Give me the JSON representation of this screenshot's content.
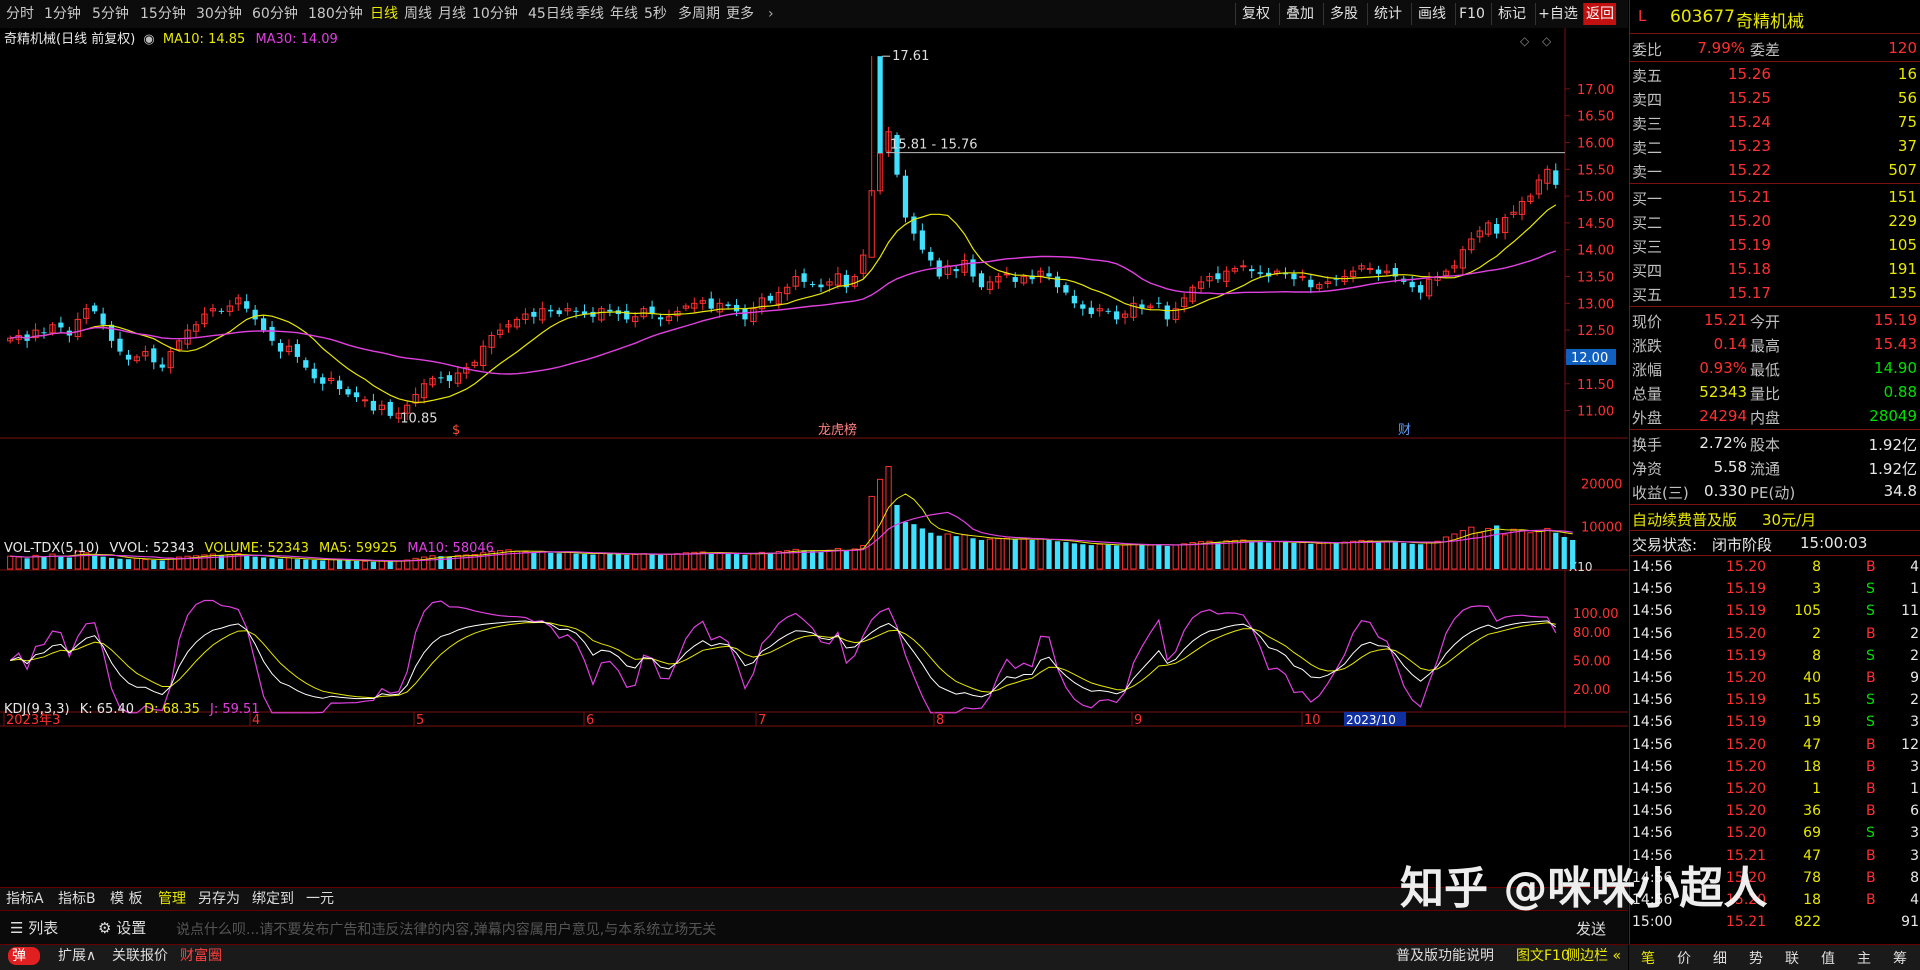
{
  "toolbar": {
    "periods": [
      "分时",
      "1分钟",
      "5分钟",
      "15分钟",
      "30分钟",
      "60分钟",
      "180分钟",
      "日线",
      "周线",
      "月线",
      "10分钟",
      "45日线",
      "季线",
      "年线",
      "5秒",
      "多周期",
      "更多"
    ],
    "selected": "日线",
    "right_buttons": [
      "复权",
      "叠加",
      "多股",
      "统计",
      "画线",
      "F10",
      "标记",
      "+自选",
      "返回"
    ]
  },
  "legends": {
    "main_title": "奇精机械(日线 前复权)",
    "ma10": "MA10: 14.85",
    "ma30": "MA30: 14.09",
    "vol_title": "VOL-TDX(5,10)",
    "vvol": "VVOL: 52343",
    "volume": "VOLUME: 52343",
    "vma5": "MA5: 59925",
    "vma10": "MA10: 58046",
    "kdj_title": "KDJ(9,3,3)",
    "k": "K: 65.40",
    "d": "D: 68.35",
    "j": "J: 59.51"
  },
  "annotations": {
    "high": "17.61",
    "low": "10.85",
    "range": "15.81 - 15.76",
    "price_tag": "12.00",
    "vol_mult": "X10",
    "mark1": "$",
    "mark2": "龙虎榜",
    "mark3": "财",
    "date_tag": "2023/10"
  },
  "chart_data": [
    {
      "type": "candlestick",
      "title": "奇精机械(日线 前复权)",
      "ylim": [
        10.6,
        17.8
      ],
      "yticks": [
        "17.00",
        "16.50",
        "16.00",
        "15.50",
        "15.00",
        "14.50",
        "14.00",
        "13.50",
        "13.00",
        "12.50",
        "12.00",
        "11.50",
        "11.00"
      ],
      "months": [
        "2023年3",
        "4",
        "5",
        "6",
        "7",
        "8",
        "9",
        "10"
      ],
      "close": [
        12.35,
        12.4,
        12.3,
        12.5,
        12.45,
        12.6,
        12.55,
        12.4,
        12.7,
        12.9,
        12.85,
        12.6,
        12.3,
        12.1,
        11.95,
        12.0,
        12.1,
        11.9,
        11.8,
        12.1,
        12.3,
        12.5,
        12.6,
        12.8,
        12.9,
        12.85,
        12.95,
        13.1,
        12.9,
        12.7,
        12.5,
        12.3,
        12.1,
        12.2,
        12.0,
        11.8,
        11.6,
        11.5,
        11.6,
        11.4,
        11.3,
        11.25,
        11.2,
        11.0,
        11.1,
        10.9,
        10.95,
        11.1,
        11.3,
        11.5,
        11.6,
        11.6,
        11.55,
        11.7,
        11.8,
        11.9,
        12.2,
        12.4,
        12.5,
        12.6,
        12.7,
        12.8,
        12.75,
        12.9,
        12.85,
        12.8,
        12.9,
        12.85,
        12.8,
        12.75,
        12.9,
        12.85,
        12.8,
        12.7,
        12.75,
        12.9,
        12.8,
        12.7,
        12.75,
        12.85,
        12.95,
        13.0,
        13.05,
        12.9,
        13.0,
        12.95,
        12.85,
        12.7,
        12.9,
        13.1,
        13.05,
        13.2,
        13.3,
        13.5,
        13.4,
        13.35,
        13.3,
        13.4,
        13.55,
        13.3,
        13.5,
        13.9,
        15.1,
        15.8,
        16.2,
        15.4,
        14.6,
        14.3,
        14.0,
        13.8,
        13.5,
        13.7,
        13.6,
        13.8,
        13.5,
        13.3,
        13.4,
        13.5,
        13.55,
        13.4,
        13.5,
        13.45,
        13.6,
        13.5,
        13.3,
        13.2,
        13.0,
        12.9,
        12.8,
        12.9,
        12.85,
        12.7,
        12.8,
        13.0,
        12.9,
        12.95,
        13.0,
        12.7,
        12.9,
        13.1,
        13.3,
        13.4,
        13.5,
        13.45,
        13.6,
        13.65,
        13.7,
        13.6,
        13.55,
        13.5,
        13.6,
        13.55,
        13.45,
        13.5,
        13.3,
        13.35,
        13.4,
        13.45,
        13.5,
        13.6,
        13.7,
        13.65,
        13.55,
        13.6,
        13.5,
        13.4,
        13.3,
        13.2,
        13.45,
        13.5,
        13.6,
        13.7,
        14.0,
        14.2,
        14.35,
        14.5,
        14.3,
        14.6,
        14.7,
        14.9,
        15.0,
        15.3,
        15.5,
        15.21
      ]
    },
    {
      "type": "bar",
      "title": "VOL-TDX(5,10)",
      "ylim": [
        0,
        26000
      ],
      "yticks": [
        "20000",
        "10000"
      ],
      "values": [
        3000,
        2800,
        2500,
        3200,
        2900,
        3500,
        3100,
        2700,
        4200,
        3800,
        3300,
        2900,
        2600,
        2400,
        2300,
        2500,
        2200,
        2100,
        2000,
        2600,
        2800,
        3000,
        3100,
        3300,
        3500,
        3200,
        3400,
        3600,
        3100,
        2900,
        2700,
        2500,
        2400,
        2600,
        2300,
        2200,
        2100,
        2000,
        2200,
        2100,
        2000,
        1900,
        1800,
        1700,
        1900,
        1800,
        1900,
        2100,
        2500,
        2800,
        3100,
        3000,
        2900,
        3200,
        3300,
        3400,
        3800,
        4100,
        4300,
        4500,
        4200,
        4000,
        3900,
        4100,
        3800,
        3700,
        3900,
        3600,
        3500,
        3400,
        3700,
        3600,
        3500,
        3300,
        3400,
        3600,
        3500,
        3300,
        3400,
        3600,
        3800,
        3900,
        4000,
        3700,
        3800,
        3600,
        3500,
        3300,
        3600,
        3900,
        3800,
        4100,
        4300,
        4600,
        4400,
        4200,
        4100,
        4400,
        4800,
        4300,
        4700,
        5500,
        17000,
        21000,
        24000,
        15000,
        11000,
        10500,
        9500,
        8500,
        7800,
        8200,
        7700,
        8000,
        7200,
        6800,
        7000,
        7100,
        7200,
        6900,
        7000,
        6800,
        7100,
        6800,
        6500,
        6300,
        6000,
        5800,
        5600,
        5800,
        5700,
        5500,
        5600,
        5800,
        5700,
        5600,
        5800,
        5400,
        5600,
        5900,
        6200,
        6400,
        6500,
        6300,
        6600,
        6700,
        6800,
        6500,
        6300,
        6200,
        6400,
        6300,
        6100,
        6200,
        5900,
        6000,
        6100,
        6200,
        6300,
        6500,
        6700,
        6600,
        6400,
        6500,
        6300,
        6100,
        5900,
        5800,
        6300,
        6500,
        7500,
        8200,
        9000,
        9800,
        8500,
        9500,
        10200,
        8000,
        9300,
        9000,
        8500,
        8800,
        9500,
        8500,
        7500,
        6800
      ]
    },
    {
      "type": "line",
      "title": "KDJ(9,3,3)",
      "ylim": [
        0,
        120
      ],
      "yticks": [
        "100.00",
        "80.00",
        "50.00",
        "20.00"
      ],
      "series": [
        {
          "name": "K",
          "color": "#ffffff"
        },
        {
          "name": "D",
          "color": "#e8e800"
        },
        {
          "name": "J",
          "color": "#e040e0"
        }
      ]
    }
  ],
  "quote": {
    "header_letter": "L",
    "code": "603677",
    "name": "奇精机械",
    "wb_label": "委比",
    "wb_value": "7.99%",
    "wc_label": "委差",
    "wc_value": "120",
    "asks": [
      {
        "label": "卖五",
        "price": "15.26",
        "vol": "16"
      },
      {
        "label": "卖四",
        "price": "15.25",
        "vol": "56"
      },
      {
        "label": "卖三",
        "price": "15.24",
        "vol": "75"
      },
      {
        "label": "卖二",
        "price": "15.23",
        "vol": "37"
      },
      {
        "label": "卖一",
        "price": "15.22",
        "vol": "507"
      }
    ],
    "bids": [
      {
        "label": "买一",
        "price": "15.21",
        "vol": "151"
      },
      {
        "label": "买二",
        "price": "15.20",
        "vol": "229"
      },
      {
        "label": "买三",
        "price": "15.19",
        "vol": "105"
      },
      {
        "label": "买四",
        "price": "15.18",
        "vol": "191"
      },
      {
        "label": "买五",
        "price": "15.17",
        "vol": "135"
      }
    ],
    "stats": [
      {
        "l1": "现价",
        "v1": "15.21",
        "c1": "red",
        "l2": "今开",
        "v2": "15.19",
        "c2": "red"
      },
      {
        "l1": "涨跌",
        "v1": "0.14",
        "c1": "red",
        "l2": "最高",
        "v2": "15.43",
        "c2": "red"
      },
      {
        "l1": "涨幅",
        "v1": "0.93%",
        "c1": "red",
        "l2": "最低",
        "v2": "14.90",
        "c2": "green"
      },
      {
        "l1": "总量",
        "v1": "52343",
        "c1": "yel",
        "l2": "量比",
        "v2": "0.88",
        "c2": "green"
      },
      {
        "l1": "外盘",
        "v1": "24294",
        "c1": "red",
        "l2": "内盘",
        "v2": "28049",
        "c2": "green"
      }
    ],
    "stats2": [
      {
        "l1": "换手",
        "v1": "2.72%",
        "l2": "股本",
        "v2": "1.92亿"
      },
      {
        "l1": "净资",
        "v1": "5.58",
        "l2": "流通",
        "v2": "1.92亿"
      },
      {
        "l1": "收益(三)",
        "v1": "0.330",
        "l2": "PE(动)",
        "v2": "34.8"
      }
    ],
    "promo": "自动续费普及版",
    "promo_price": "30元/月",
    "status_label": "交易状态:",
    "status_value": "闭市阶段",
    "status_time": "15:00:03",
    "ticks": [
      {
        "t": "14:56",
        "p": "15.20",
        "pc": "red",
        "v": "8",
        "bs": "B",
        "n": "4"
      },
      {
        "t": "14:56",
        "p": "15.19",
        "pc": "red",
        "v": "3",
        "bs": "S",
        "n": "1"
      },
      {
        "t": "14:56",
        "p": "15.19",
        "pc": "red",
        "v": "105",
        "bs": "S",
        "n": "11"
      },
      {
        "t": "14:56",
        "p": "15.20",
        "pc": "red",
        "v": "2",
        "bs": "B",
        "n": "2"
      },
      {
        "t": "14:56",
        "p": "15.19",
        "pc": "red",
        "v": "8",
        "bs": "S",
        "n": "2"
      },
      {
        "t": "14:56",
        "p": "15.20",
        "pc": "red",
        "v": "40",
        "bs": "B",
        "n": "9"
      },
      {
        "t": "14:56",
        "p": "15.19",
        "pc": "red",
        "v": "15",
        "bs": "S",
        "n": "2"
      },
      {
        "t": "14:56",
        "p": "15.19",
        "pc": "red",
        "v": "19",
        "bs": "S",
        "n": "3"
      },
      {
        "t": "14:56",
        "p": "15.20",
        "pc": "red",
        "v": "47",
        "bs": "B",
        "n": "12"
      },
      {
        "t": "14:56",
        "p": "15.20",
        "pc": "red",
        "v": "18",
        "bs": "B",
        "n": "3"
      },
      {
        "t": "14:56",
        "p": "15.20",
        "pc": "red",
        "v": "1",
        "bs": "B",
        "n": "1"
      },
      {
        "t": "14:56",
        "p": "15.20",
        "pc": "red",
        "v": "36",
        "bs": "B",
        "n": "6"
      },
      {
        "t": "14:56",
        "p": "15.20",
        "pc": "red",
        "v": "69",
        "bs": "S",
        "n": "3"
      },
      {
        "t": "14:56",
        "p": "15.21",
        "pc": "red",
        "v": "47",
        "bs": "B",
        "n": "3"
      },
      {
        "t": "14:56",
        "p": "15.20",
        "pc": "red",
        "v": "78",
        "bs": "B",
        "n": "8"
      },
      {
        "t": "14:56",
        "p": "15.20",
        "pc": "red",
        "v": "18",
        "bs": "B",
        "n": "4"
      },
      {
        "t": "15:00",
        "p": "15.21",
        "pc": "red",
        "v": "822",
        "bs": "",
        "n": "91"
      }
    ]
  },
  "bottom": {
    "tabs": [
      "指标A",
      "指标B",
      "模 板",
      "管理",
      "另存为",
      "绑定到",
      "一元"
    ],
    "selected_tab": "管理",
    "list_label": "列表",
    "settings_label": "设置",
    "comment_placeholder": "说点什么呗...请不要发布广告和违反法律的内容,弹幕内容属用户意见,与本系统立场无关",
    "send_label": "发送",
    "bar3": [
      "弹",
      "扩展∧",
      "关联报价",
      "财富圈"
    ],
    "bar3_right": [
      "普及版功能说明",
      "图文F10",
      "侧边栏 «"
    ],
    "right_tabs": [
      "笔",
      "价",
      "细",
      "势",
      "联",
      "值",
      "主",
      "筹"
    ]
  },
  "watermark": "知乎 @咪咪小超人",
  "colors": {
    "up": "#ff3030",
    "down": "#40e0ff",
    "ma10": "#e8e800",
    "ma30": "#e040e0",
    "border": "#7a1010"
  }
}
